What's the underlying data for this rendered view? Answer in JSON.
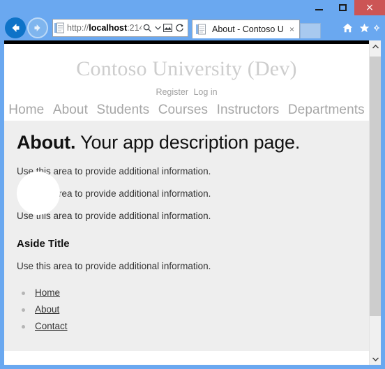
{
  "browser": {
    "window_controls": {
      "minimize": "minimize-button",
      "maximize": "maximize-button",
      "close_label": "×"
    },
    "back_label": "Back",
    "forward_label": "Forward",
    "address": {
      "scheme": "http://",
      "host": "localhost",
      "port": ":214",
      "full": "http://localhost:214",
      "search_icon": "search-icon",
      "dropdown_icon": "chevron-down-icon",
      "compat_icon": "compatibility-view-icon",
      "refresh_icon": "refresh-icon"
    },
    "tab": {
      "title": "About - Contoso Univ...",
      "close_label": "×"
    },
    "new_tab_label": "",
    "right_buttons": [
      {
        "name": "home-icon",
        "label": "Home"
      },
      {
        "name": "favorites-icon",
        "label": "Favorites"
      },
      {
        "name": "tools-icon",
        "label": "Tools"
      }
    ]
  },
  "page": {
    "brand": "Contoso University (Dev)",
    "auth_links": [
      {
        "label": "Register"
      },
      {
        "label": "Log in"
      }
    ],
    "nav": [
      {
        "label": "Home"
      },
      {
        "label": "About"
      },
      {
        "label": "Students"
      },
      {
        "label": "Courses"
      },
      {
        "label": "Instructors"
      },
      {
        "label": "Departments"
      }
    ],
    "heading_bold": "About.",
    "heading_rest": "Your app description page.",
    "paragraphs": [
      "Use this area to provide additional information.",
      "Use this area to provide additional information.",
      "Use this area to provide additional information."
    ],
    "aside_title": "Aside Title",
    "aside_paragraph": "Use this area to provide additional information.",
    "footer_links": [
      {
        "label": "Home"
      },
      {
        "label": "About"
      },
      {
        "label": "Contact"
      }
    ]
  },
  "colors": {
    "frame": "#6aa8f0",
    "close": "#cc5555",
    "content_bg": "#eeeeee",
    "brand_text": "#cdcdcd",
    "nav_text": "#a6a6a6"
  }
}
